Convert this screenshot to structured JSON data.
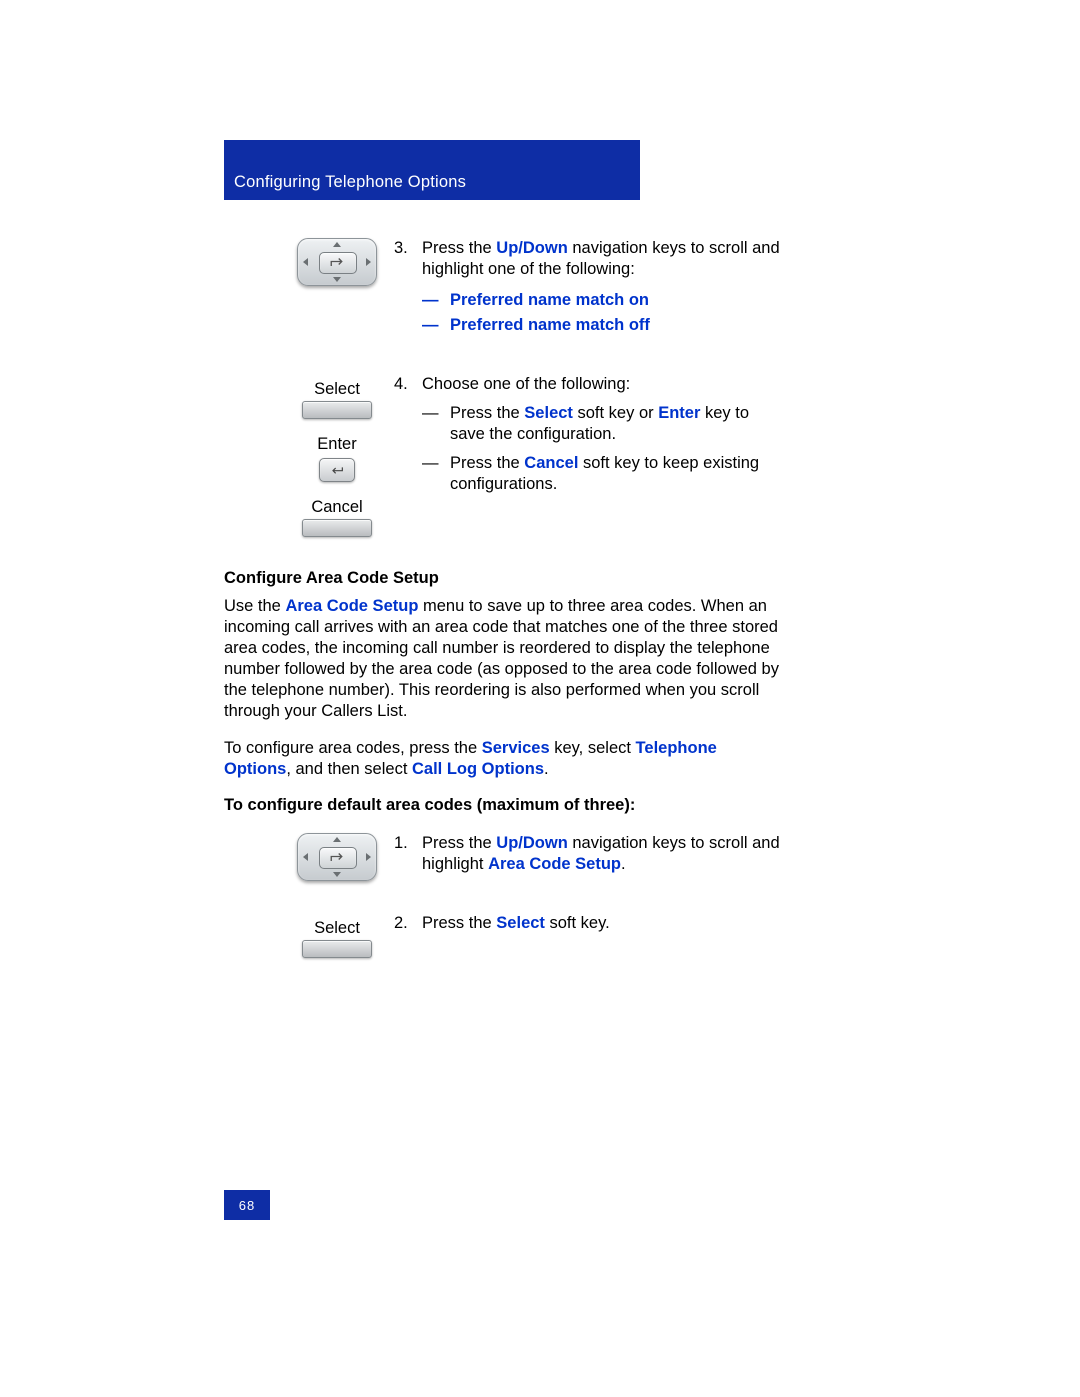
{
  "header": {
    "title": "Configuring Telephone Options"
  },
  "step3": {
    "num": "3.",
    "lead": "Press the ",
    "key": "Up/Down",
    "tail": " navigation keys to scroll and highlight one of the following:",
    "opt1_dash": "—",
    "opt1": "Preferred name match on",
    "opt2_dash": "—",
    "opt2": "Preferred name match off"
  },
  "keys": {
    "select": "Select",
    "enter": "Enter",
    "cancel": "Cancel"
  },
  "step4": {
    "num": "4.",
    "lead": "Choose one of the following:",
    "a_dash": "—",
    "a_pre": "Press the ",
    "a_sel": "Select",
    "a_mid": " soft key or ",
    "a_ent": "Enter",
    "a_post": " key to save the configuration.",
    "b_dash": "—",
    "b_pre": "Press the ",
    "b_can": "Cancel",
    "b_post": " soft key to keep existing configurations."
  },
  "section": {
    "heading": "Configure Area Code Setup",
    "p1_pre": "Use the ",
    "p1_link": "Area Code Setup",
    "p1_post": " menu to save up to three area codes. When an incoming call arrives with an area code that matches one of the three stored area codes, the incoming call number is reordered to display the telephone number followed by the area code (as opposed to the area code followed by the telephone number). This reordering is also performed when you scroll through your Callers List.",
    "p2_pre": "To configure area codes, press the ",
    "p2_services": "Services",
    "p2_mid1": " key, select ",
    "p2_telopt": "Telephone Options",
    "p2_mid2": ", and then select ",
    "p2_calllog": "Call Log Options",
    "p2_end": ".",
    "subheading": "To configure default area codes (maximum of three):"
  },
  "stepA1": {
    "num": "1.",
    "lead": "Press the ",
    "key": "Up/Down",
    "mid": " navigation keys to scroll and highlight ",
    "target": "Area Code Setup",
    "end": "."
  },
  "stepA2": {
    "num": "2.",
    "lead": "Press the ",
    "sel": "Select",
    "end": " soft key."
  },
  "footer": {
    "page": "68"
  }
}
